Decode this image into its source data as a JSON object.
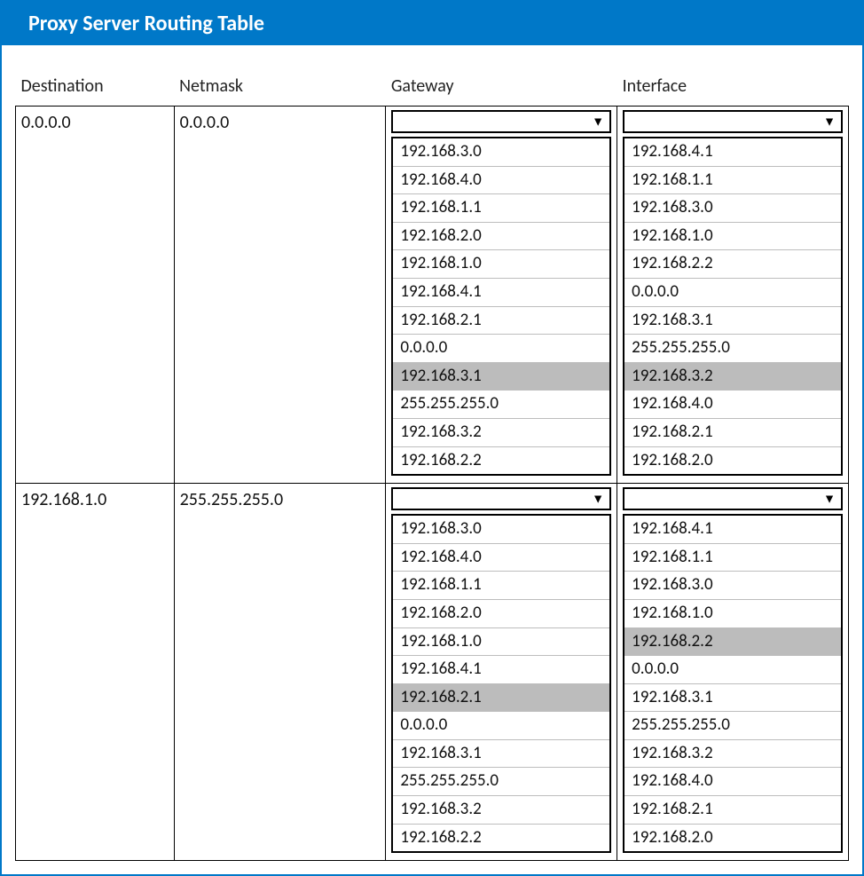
{
  "title": "Proxy Server Routing Table",
  "headers": {
    "destination": "Destination",
    "netmask": "Netmask",
    "gateway": "Gateway",
    "interface": "Interface"
  },
  "rows": [
    {
      "destination": "0.0.0.0",
      "netmask": "0.0.0.0",
      "gateway": {
        "selected": "",
        "highlight_index": 8,
        "options": [
          "192.168.3.0",
          "192.168.4.0",
          "192.168.1.1",
          "192.168.2.0",
          "192.168.1.0",
          "192.168.4.1",
          "192.168.2.1",
          "0.0.0.0",
          "192.168.3.1",
          "255.255.255.0",
          "192.168.3.2",
          "192.168.2.2"
        ]
      },
      "interface": {
        "selected": "",
        "highlight_index": 8,
        "options": [
          "192.168.4.1",
          "192.168.1.1",
          "192.168.3.0",
          "192.168.1.0",
          "192.168.2.2",
          "0.0.0.0",
          "192.168.3.1",
          "255.255.255.0",
          "192.168.3.2",
          "192.168.4.0",
          "192.168.2.1",
          "192.168.2.0"
        ]
      }
    },
    {
      "destination": "192.168.1.0",
      "netmask": "255.255.255.0",
      "gateway": {
        "selected": "",
        "highlight_index": 6,
        "options": [
          "192.168.3.0",
          "192.168.4.0",
          "192.168.1.1",
          "192.168.2.0",
          "192.168.1.0",
          "192.168.4.1",
          "192.168.2.1",
          "0.0.0.0",
          "192.168.3.1",
          "255.255.255.0",
          "192.168.3.2",
          "192.168.2.2"
        ]
      },
      "interface": {
        "selected": "",
        "highlight_index": 4,
        "options": [
          "192.168.4.1",
          "192.168.1.1",
          "192.168.3.0",
          "192.168.1.0",
          "192.168.2.2",
          "0.0.0.0",
          "192.168.3.1",
          "255.255.255.0",
          "192.168.3.2",
          "192.168.4.0",
          "192.168.2.1",
          "192.168.2.0"
        ]
      }
    }
  ]
}
